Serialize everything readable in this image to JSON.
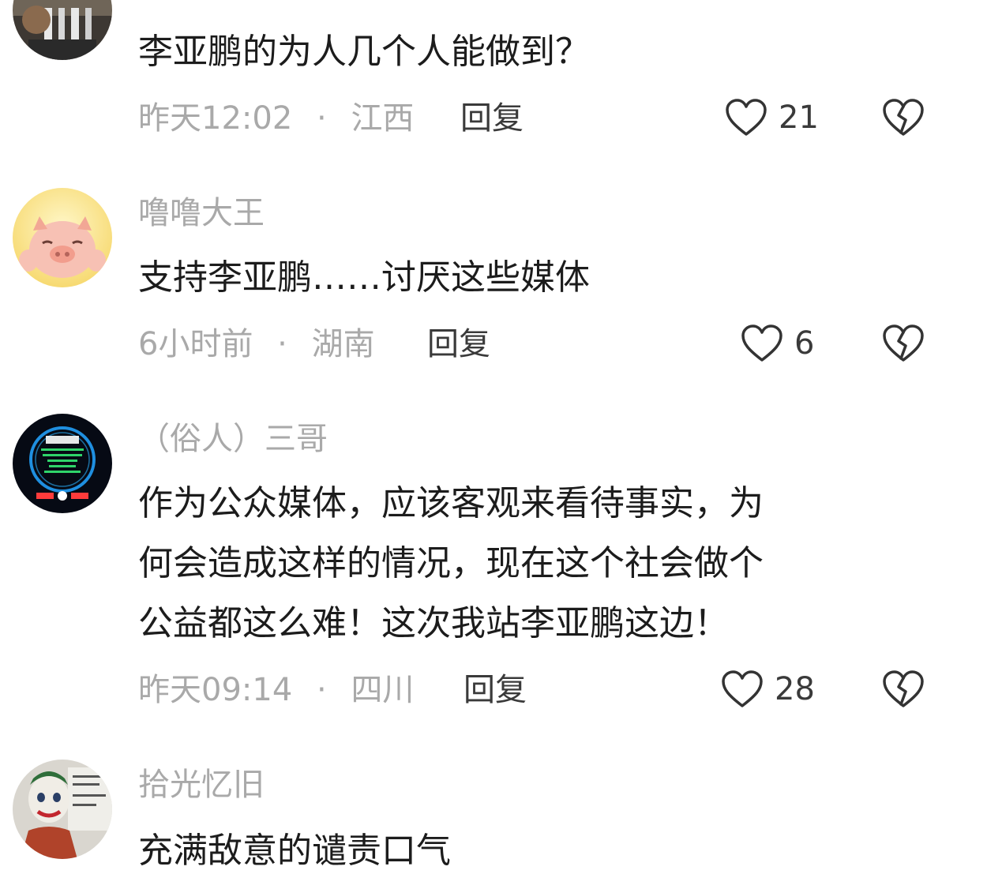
{
  "comments": [
    {
      "username": "",
      "content_lines": [
        "李亚鹏的为人几个人能做到？"
      ],
      "time": "昨天12:02",
      "location": "江西",
      "reply_label": "回复",
      "likes": "21"
    },
    {
      "username": "噜噜大王",
      "content_lines": [
        "支持李亚鹏……讨厌这些媒体"
      ],
      "time": "6小时前",
      "location": "湖南",
      "reply_label": "回复",
      "likes": "6"
    },
    {
      "username": "（俗人）三哥",
      "content_lines": [
        "作为公众媒体，应该客观来看待事实，为",
        "何会造成这样的情况，现在这个社会做个",
        "公益都这么难！这次我站李亚鹏这边！"
      ],
      "time": "昨天09:14",
      "location": "四川",
      "reply_label": "回复",
      "likes": "28"
    },
    {
      "username": "拾光忆旧",
      "content_lines": [
        "充满敌意的谴责口气"
      ]
    }
  ],
  "separator": "·",
  "colors": {
    "meta_text": "#a9a9a9",
    "body_text": "#1c1c1c",
    "icon_stroke": "#333333"
  },
  "icons": {
    "like": "heart-outline-icon",
    "dislike": "broken-heart-icon"
  }
}
